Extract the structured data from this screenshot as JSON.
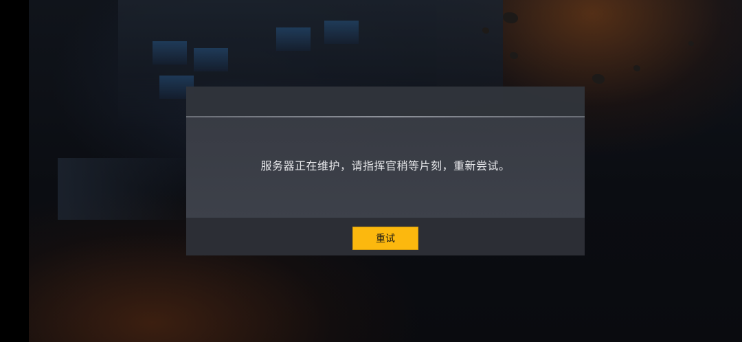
{
  "dialog": {
    "message": "服务器正在维护，请指挥官稍等片刻，重新尝试。",
    "retry_label": "重试"
  },
  "colors": {
    "accent_button": "#fcb80e",
    "dialog_bg": "#373a42",
    "footer_bg": "#2c2e35",
    "message_text": "#e6e7ea"
  }
}
